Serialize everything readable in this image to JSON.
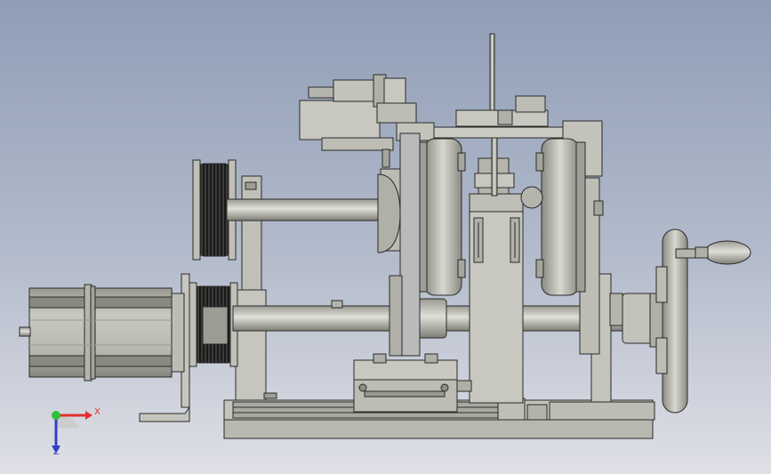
{
  "scene": {
    "background_top": "#8f9db6",
    "background_bottom": "#dfe0e6",
    "part_fill": "#c4c4bc",
    "part_dark": "#8e8e86",
    "part_edge": "#2a2a2a"
  },
  "triad": {
    "x_label": "X",
    "z_label": "Z",
    "x_color": "#e33030",
    "y_color": "#2fbf3a",
    "z_color": "#3340c8"
  }
}
